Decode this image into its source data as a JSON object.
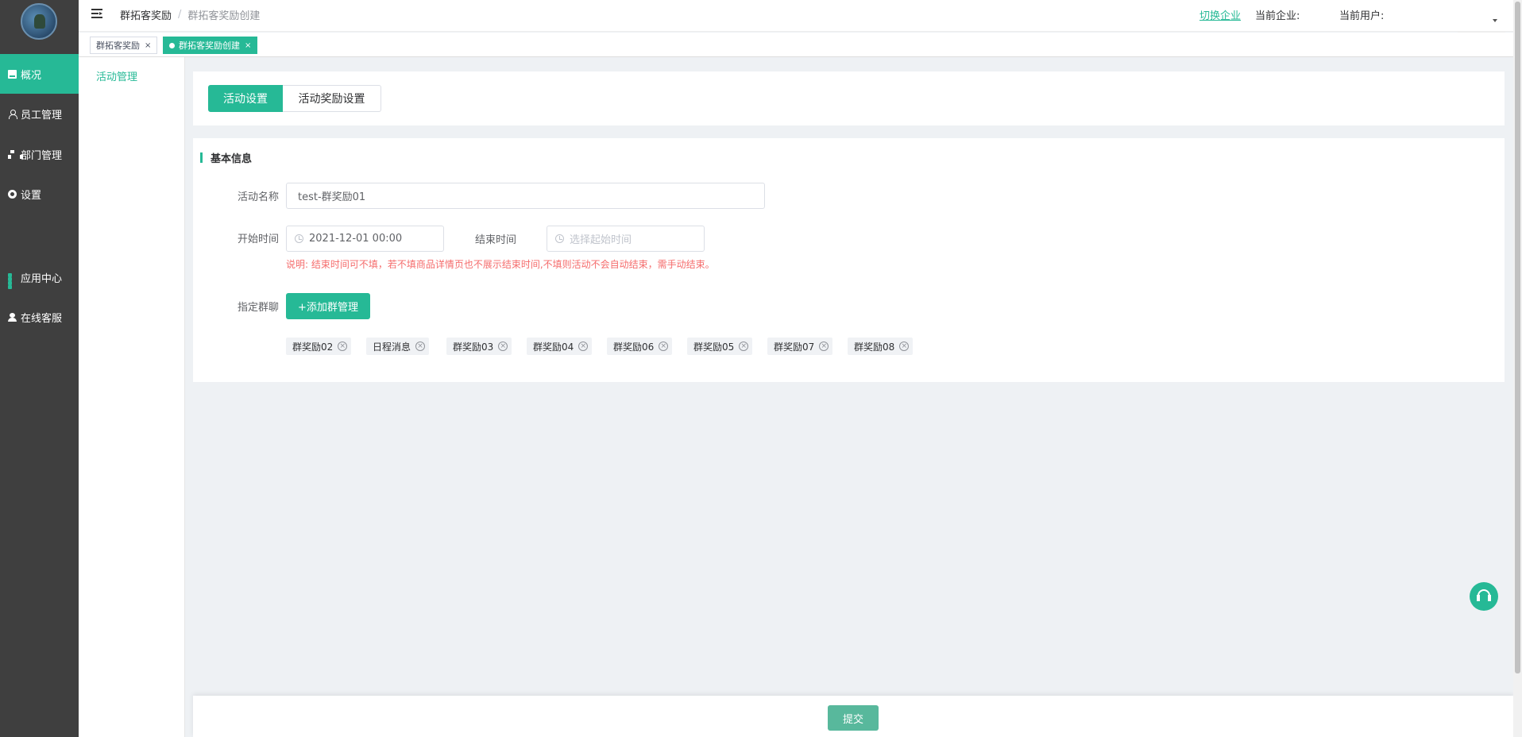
{
  "sidebar": {
    "items": [
      {
        "label": "概况",
        "icon": "overview-icon",
        "active": true
      },
      {
        "label": "员工管理",
        "icon": "user-icon"
      },
      {
        "label": "部门管理",
        "icon": "department-icon"
      },
      {
        "label": "设置",
        "icon": "gear-icon"
      },
      {
        "label": "应用中心",
        "icon": "apps-icon"
      },
      {
        "label": "在线客服",
        "icon": "service-icon"
      }
    ]
  },
  "submenu": {
    "items": [
      {
        "label": "活动管理"
      }
    ]
  },
  "header": {
    "breadcrumb": [
      "群拓客奖励",
      "群拓客奖励创建"
    ],
    "breadcrumb_sep": "/",
    "switch_company": "切换企业",
    "current_company_label": "当前企业:",
    "current_user_label": "当前用户:"
  },
  "tags": [
    {
      "label": "群拓客奖励",
      "close": "×"
    },
    {
      "label": "群拓客奖励创建",
      "close": "×",
      "active": true
    }
  ],
  "tabs": [
    {
      "label": "活动设置",
      "active": true
    },
    {
      "label": "活动奖励设置"
    }
  ],
  "form": {
    "section_title": "基本信息",
    "name_label": "活动名称",
    "name_value": "test-群奖励01",
    "start_label": "开始时间",
    "start_value": "2021-12-01 00:00",
    "end_label": "结束时间",
    "end_placeholder": "选择起始时间",
    "note": "说明: 结束时间可不填，若不填商品详情页也不展示结束时间,不填则活动不会自动结束，需手动结束。",
    "group_label": "指定群聊",
    "add_group_button": "+添加群管理",
    "groups": [
      "群奖励02",
      "日程消息",
      "群奖励03",
      "群奖励04",
      "群奖励06",
      "群奖励05",
      "群奖励07",
      "群奖励08"
    ]
  },
  "footer": {
    "submit": "提交"
  },
  "colors": {
    "accent": "#26b996",
    "sidebar_bg": "#3f3f3f",
    "note": "#f56c6c",
    "page_bg": "#eef1f4"
  }
}
